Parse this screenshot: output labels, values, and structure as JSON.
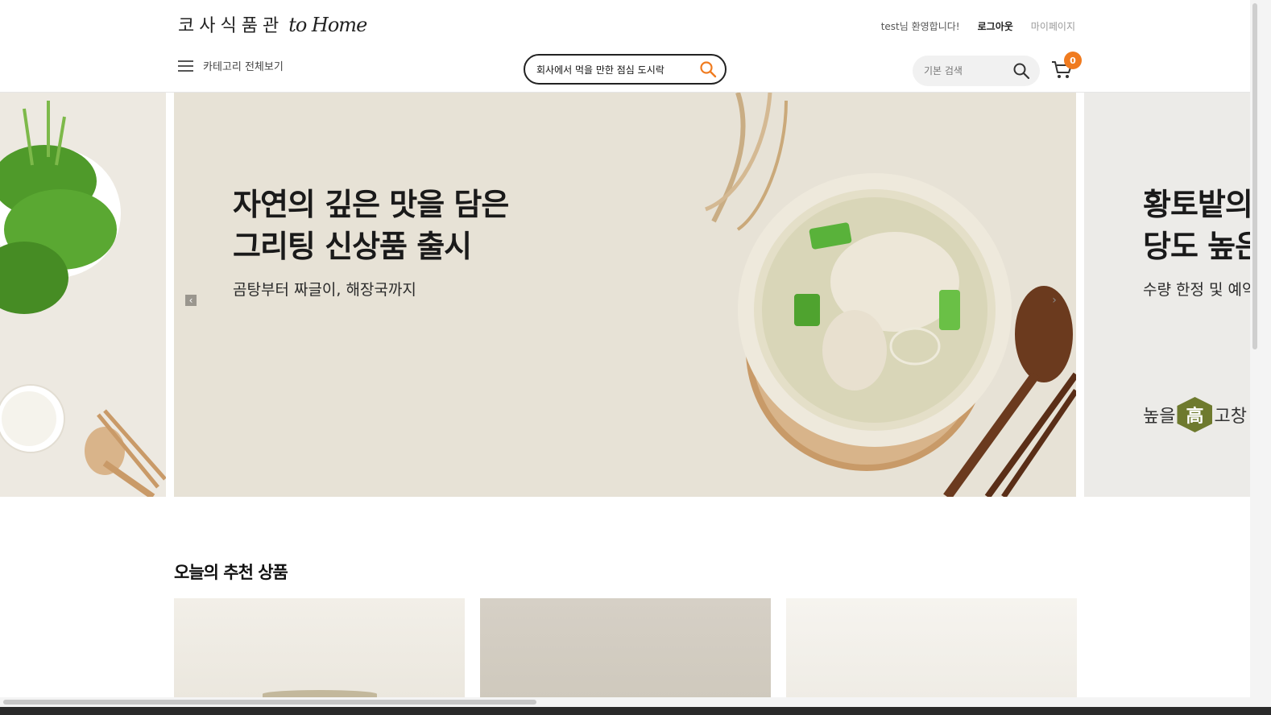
{
  "header": {
    "logo_korean": "코사식품관",
    "logo_english": "to Home",
    "util_links": {
      "welcome": "test님 환영합니다!",
      "logout": "로그아웃",
      "mypage": "마이페이지"
    },
    "category_menu_label": "카테고리 전체보기",
    "ai_search": {
      "value": "회사에서 먹을 만한 점심 도시락",
      "icon": "search-icon"
    },
    "basic_search": {
      "placeholder": "기본 검색",
      "icon": "search-icon"
    },
    "cart": {
      "count": "0",
      "icon": "cart-icon"
    }
  },
  "banner": {
    "main_slide": {
      "title_line1": "자연의 깊은 맛을 담은",
      "title_line2": "그리팅 신상품 출시",
      "subtitle": "곰탕부터 짜글이, 해장국까지"
    },
    "next_slide": {
      "title_line1": "황토밭의",
      "title_line2": "당도 높은",
      "subtitle": "수량 한정 및 예약",
      "brand_left": "높을",
      "brand_mark": "高",
      "brand_right": "고창"
    },
    "prev_arrow": "‹",
    "next_arrow": "›"
  },
  "recommend": {
    "section_title": "오늘의 추천 상품"
  },
  "colors": {
    "accent": "#f07b1f",
    "banner_bg": "#e7e2d6",
    "brand_green": "#6e7a2e"
  }
}
